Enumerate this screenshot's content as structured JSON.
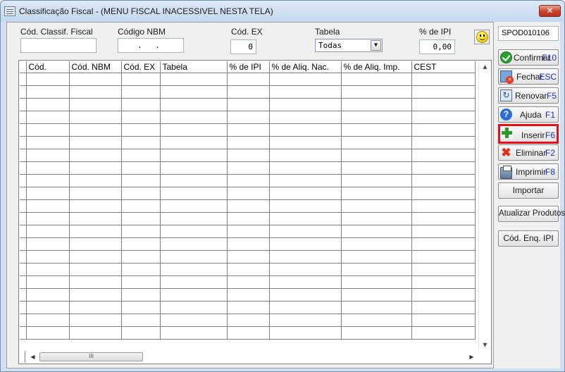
{
  "window": {
    "title": "Classificação Fiscal - (MENU FISCAL INACESSIVEL NESTA TELA)",
    "close_symbol": "✕"
  },
  "filters": {
    "classif_label": "Cód. Classif. Fiscal",
    "classif_value": "",
    "nbm_label": "Código NBM",
    "nbm_value": ". .",
    "ex_label": "Cód. EX",
    "ex_value": "0",
    "tabela_label": "Tabela",
    "tabela_value": "Todas",
    "ipi_label": "% de IPI",
    "ipi_value": "0,00"
  },
  "grid": {
    "columns": [
      "Cód.",
      "Cód. NBM",
      "Cód. EX",
      "Tabela",
      "% de IPI",
      "% de Aliq. Nac.",
      "% de Aliq. Imp.",
      "CEST"
    ],
    "empty_rows": 21,
    "scroll_thumb_grip": "III"
  },
  "side": {
    "code": "SPOD010106",
    "buttons": [
      {
        "label": "Confirmar",
        "key": "F10",
        "icon": "check-icon"
      },
      {
        "label": "Fechar",
        "key": "ESC",
        "icon": "exit-icon"
      },
      {
        "label": "Renovar",
        "key": "F5",
        "icon": "refresh-icon"
      },
      {
        "label": "Ajuda",
        "key": "F1",
        "icon": "help-icon"
      },
      {
        "label": "Inserir",
        "key": "F6",
        "icon": "plus-icon"
      },
      {
        "label": "Eliminar",
        "key": "F2",
        "icon": "x-icon"
      },
      {
        "label": "Imprimir",
        "key": "F8",
        "icon": "printer-icon"
      }
    ],
    "importar": "Importar",
    "atualizar": "Atualizar Produtos",
    "cod_enq": "Cód. Enq. IPI"
  },
  "colors": {
    "selected_border": "#e3101a",
    "shortcut_key": "#1730b8"
  }
}
